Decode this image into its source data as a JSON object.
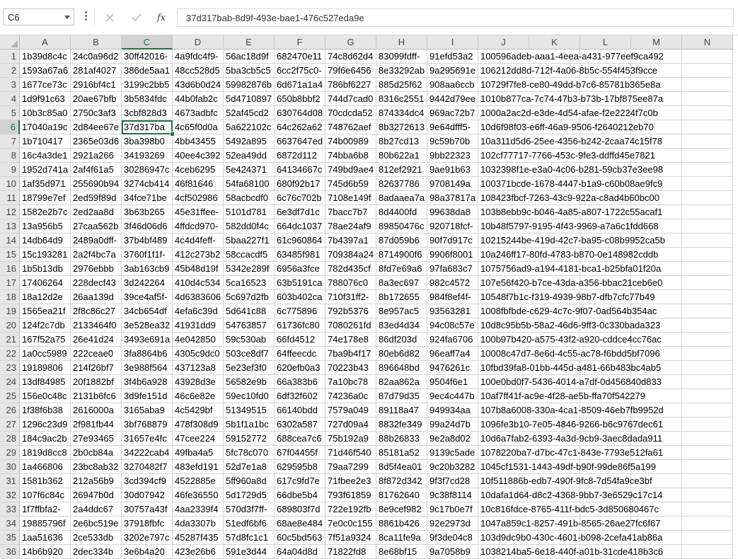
{
  "name_box": {
    "value": "C6"
  },
  "formula_bar": {
    "cancel_icon": "close-icon",
    "enter_icon": "check-icon",
    "fx_label": "fx",
    "value": "37d317bab-8d9f-493e-bae1-476c527eda9e"
  },
  "active_cell": {
    "col": "C",
    "row": 6
  },
  "columns": [
    "A",
    "B",
    "C",
    "D",
    "E",
    "F",
    "G",
    "H",
    "I",
    "J",
    "K",
    "L",
    "M",
    "N"
  ],
  "selected_column": "C",
  "rows": [
    {
      "n": "1",
      "a": "1b39d8c4c",
      "b": "24c0a96d2",
      "c": "30ff42016-",
      "d": "4a9fdc4f9-",
      "e": "56ac18d9f",
      "f": "682470e11",
      "g": "74c8d62d4",
      "h": "83099fdff-",
      "i": "91efd53a2",
      "j": "100596adeb-aaa1-4eea-a431-977eef9ca492"
    },
    {
      "n": "2",
      "a": "1593a67a6",
      "b": "281af4027",
      "c": "386de5aa1",
      "d": "48cc528d5",
      "e": "5ba3cb5c5",
      "f": "6cc2f75c0-",
      "g": "79f6e6456",
      "h": "8e33292ab",
      "i": "9a295691e",
      "j": "106212dd8d-712f-4a06-8b5c-554f453f9cce"
    },
    {
      "n": "3",
      "a": "1677ce73c",
      "b": "2916bf4c1",
      "c": "3199c2bb5",
      "d": "43d6b0d24",
      "e": "59982876b",
      "f": "6d671a1a4",
      "g": "786bf6227",
      "h": "885d25f62",
      "i": "908aa6ccb",
      "j": "10729f7fe8-ce80-49dd-b7c6-85781b365e8a"
    },
    {
      "n": "4",
      "a": "1d9f91c63",
      "b": "20ae67bfb",
      "c": "3b5834fdc",
      "d": "44b0fab2c",
      "e": "5d4710897",
      "f": "650b8bbf2",
      "g": "744d7cad0",
      "h": "8316c2551",
      "i": "9442d79ee",
      "j": "1010b877ca-7c74-47b3-b73b-17bf875ee87a"
    },
    {
      "n": "5",
      "a": "10b3c85a0",
      "b": "2750c3af3",
      "c": "3cbf828d3",
      "d": "4673adbfc",
      "e": "52af45cd2",
      "f": "630764d08",
      "g": "70cdcda52",
      "h": "874334dc4",
      "i": "969ac72b7",
      "j": "1000a2ac2d-e3de-4d54-afae-f2e2224f7c0b"
    },
    {
      "n": "6",
      "a": "17040a19c",
      "b": "2d84ee67e",
      "c": "37d317ba",
      "d": "4c65f0d0a",
      "e": "5a622102c",
      "f": "64c262a62",
      "g": "748762aef",
      "h": "8b3272613",
      "i": "9e64dfff5-",
      "j": "10d6f98f03-e6ff-46a9-9506-f2640212eb70"
    },
    {
      "n": "7",
      "a": "1b710417",
      "b": "2365e03d6",
      "c": "3ba398b0",
      "d": "4bb43455",
      "e": "5492a895",
      "f": "6637647ed",
      "g": "74b00989",
      "h": "8b27cd13",
      "i": "9c59b70b",
      "j": "10a311d5d6-25ee-4356-b242-2caa74c15f78"
    },
    {
      "n": "8",
      "a": "16c4a3de1",
      "b": "2921a266",
      "c": "34193269",
      "d": "40ee4c392",
      "e": "52ea49dd",
      "f": "6872d112",
      "g": "74bba6b8",
      "h": "80b622a1",
      "i": "9bb22323",
      "j": "102cf77717-7766-453c-9fe3-ddffd45e7821"
    },
    {
      "n": "9",
      "a": "1952d741a",
      "b": "2af4f61a5",
      "c": "30286947c",
      "d": "4ceb6295",
      "e": "5e424371",
      "f": "64134667c",
      "g": "749bd9ae4",
      "h": "812ef2921",
      "i": "9ae91b63",
      "j": "1032398f1e-e3a0-4c06-b281-59cb37e3ee98"
    },
    {
      "n": "10",
      "a": "1af35d971",
      "b": "255690b94",
      "c": "3274cb414",
      "d": "46f81646",
      "e": "54fa68100",
      "f": "680f92b17",
      "g": "745d6b59",
      "h": "82637786",
      "i": "9708149a",
      "j": "100371bcde-1678-4447-b1a9-c60b08ae9fc9"
    },
    {
      "n": "11",
      "a": "18799e7ef",
      "b": "2ed59f89d",
      "c": "34fce71be",
      "d": "4cf502986",
      "e": "58acbcdf0",
      "f": "6c76c702b",
      "g": "7108e149f",
      "h": "8adaaea7a",
      "i": "98a37817a",
      "j": "108423fbcf-7263-43c9-922a-c8ad4b60bc00"
    },
    {
      "n": "12",
      "a": "1582e2b7c",
      "b": "2ed2aa8d",
      "c": "3b63b265",
      "d": "45e31ffee-",
      "e": "5101d781",
      "f": "6e3df7d1c",
      "g": "7bacc7b7",
      "h": "8d4400fd",
      "i": "99638da8",
      "j": "103b8ebb9c-b046-4a85-a807-1722c55acaf1"
    },
    {
      "n": "13",
      "a": "13a956b5",
      "b": "27caa562b",
      "c": "3f46d06d6",
      "d": "4ffdcd970-",
      "e": "582dd0f4c",
      "f": "664dc1037",
      "g": "78ae24af9",
      "h": "89850476c",
      "i": "920718fcf-",
      "j": "10b48f5797-9195-4f43-9969-a7a6c1fdd668"
    },
    {
      "n": "14",
      "a": "14db64d9",
      "b": "2489a0dff-",
      "c": "37b4bf489",
      "d": "4c4d4feff-",
      "e": "5baa227f1",
      "f": "61c960864",
      "g": "7b4397a1",
      "h": "87d059b6",
      "i": "90f7d917c",
      "j": "10215244be-419d-42c7-ba95-c08b9952ca5b"
    },
    {
      "n": "15",
      "a": "15c193281",
      "b": "2a2f4bc7a",
      "c": "3760f1f1f-",
      "d": "412c273b2",
      "e": "58ccacdf5",
      "f": "63485f981",
      "g": "709384a24",
      "h": "8714900f6",
      "i": "9906f8001",
      "j": "10a246ff17-80fd-4783-b870-0e148982cddb"
    },
    {
      "n": "16",
      "a": "1b5b13db",
      "b": "2976ebbb",
      "c": "3ab163cb9",
      "d": "45b48d19f",
      "e": "5342e289f",
      "f": "6956a3fce",
      "g": "782d435cf",
      "h": "8fd7e69a6",
      "i": "97fa683c7",
      "j": "1075756ad9-a194-4181-bca1-b25bfa01f20a"
    },
    {
      "n": "17",
      "a": "17406264",
      "b": "228decf43",
      "c": "3d242264",
      "d": "410d4c534",
      "e": "5ca16523",
      "f": "63b5191ca",
      "g": "788076c0",
      "h": "8a3ec697",
      "i": "982c4572",
      "j": "107e56f420-b7ce-43da-a356-bbac21ceb6e0"
    },
    {
      "n": "18",
      "a": "18a12d2e",
      "b": "26aa139d",
      "c": "39ce4af5f-",
      "d": "4d6383606",
      "e": "5c697d2fb",
      "f": "603b402ca",
      "g": "710f31ff2-",
      "h": "8b172655",
      "i": "984f8ef4f-",
      "j": "10548f7b1c-f319-4939-98b7-dfb7cfc77b49"
    },
    {
      "n": "19",
      "a": "1565ea21f",
      "b": "2f8c86c27",
      "c": "34cb654df",
      "d": "4efa6c39d",
      "e": "5d641c88",
      "f": "6c775896",
      "g": "792b5376",
      "h": "8e957ac5",
      "i": "93563281",
      "j": "1008fbfbde-c629-4c7c-9f07-0ad564b354ac"
    },
    {
      "n": "20",
      "a": "124f2c7db",
      "b": "2133464f0",
      "c": "3e528ea32",
      "d": "41931dd9",
      "e": "54763857",
      "f": "61736fc80",
      "g": "7080261fd",
      "h": "83ed4d34",
      "i": "94c08c57e",
      "j": "10d8c95b5b-58a2-46d6-9ff3-0c330bada323"
    },
    {
      "n": "21",
      "a": "167f52a75",
      "b": "26e41d24",
      "c": "3493e691a",
      "d": "4e042850",
      "e": "59c530ab",
      "f": "66fd4512",
      "g": "74e178e8",
      "h": "86df203d",
      "i": "924fa6706",
      "j": "100b97b420-a575-43f2-a920-cddce4cc76ac"
    },
    {
      "n": "22",
      "a": "1a0cc5989",
      "b": "222ceae0",
      "c": "3fa8864b6",
      "d": "4305c9dc0",
      "e": "503ce8df7",
      "f": "64ffeecdc",
      "g": "7ba9b4f17",
      "h": "80eb6d82",
      "i": "96eaff7a4",
      "j": "10008c47d7-8e6d-4c55-ac78-f6bdd5bf7096"
    },
    {
      "n": "23",
      "a": "19189806",
      "b": "214f26bf7",
      "c": "3e988f564",
      "d": "437123a8",
      "e": "5e23ef3f0",
      "f": "620efb0a3",
      "g": "70223b43",
      "h": "896648bd",
      "i": "9476261c",
      "j": "10fbd39fa8-01bb-445d-a481-66b483bc4ab5"
    },
    {
      "n": "24",
      "a": "13df84985",
      "b": "20f1882bf",
      "c": "3f4b6a928",
      "d": "43928d3e",
      "e": "56582e9b",
      "f": "66a383b6",
      "g": "7a10bc78",
      "h": "82aa862a",
      "i": "9504f6e1",
      "j": "100e0bd0f7-5436-4014-a7df-0d456840d833"
    },
    {
      "n": "25",
      "a": "156e0c48c",
      "b": "2131b6fc6",
      "c": "3d9fe151d",
      "d": "46c6e82e",
      "e": "59ec10fd0",
      "f": "6df32f602",
      "g": "74236a0c",
      "h": "87d79d35",
      "i": "9ec4c447b",
      "j": "10af7ff41f-ac9e-4f28-ae5b-ffa70f542279"
    },
    {
      "n": "26",
      "a": "1f38f6b38",
      "b": "2616000a",
      "c": "3165aba9",
      "d": "4c5429bf",
      "e": "51349515",
      "f": "66140bdd",
      "g": "7579a049",
      "h": "89118a47",
      "i": "949934aa",
      "j": "107b8a6008-330a-4ca1-8509-46eb7fb9952d"
    },
    {
      "n": "27",
      "a": "1296c23d9",
      "b": "2f981fb44",
      "c": "3bf768879",
      "d": "478f308d9",
      "e": "5b1f1a1bc",
      "f": "6302a587",
      "g": "727d09a4",
      "h": "8832fe349",
      "i": "99a24d7b",
      "j": "1096fe3b10-7e05-4846-9266-b6c9767dec61"
    },
    {
      "n": "28",
      "a": "184c9ac2b",
      "b": "27e93465",
      "c": "31657e4fc",
      "d": "47cee224",
      "e": "59152772",
      "f": "688cea7c6",
      "g": "75b192a9",
      "h": "88b26833",
      "i": "9e2a8d02",
      "j": "10d6a7fab2-6393-4a3d-9cb9-3aec8dada911"
    },
    {
      "n": "29",
      "a": "1819d8cc8",
      "b": "2b0cb84a",
      "c": "34222cab4",
      "d": "49fba4a5",
      "e": "5fc78c070",
      "f": "67f04455f",
      "g": "71d46f540",
      "h": "85181a52",
      "i": "9139c5ade",
      "j": "1078220ba7-d7bc-47c1-843e-7793e512fa61"
    },
    {
      "n": "30",
      "a": "1a466806",
      "b": "23bc8ab32",
      "c": "3270482f7",
      "d": "483efd191",
      "e": "52d7e1a8",
      "f": "629595b8",
      "g": "79aa7299",
      "h": "8d5f4ea01",
      "i": "9c20b3282",
      "j": "1045cf1531-1443-49df-b90f-99de86f5a199"
    },
    {
      "n": "31",
      "a": "1581b362",
      "b": "212a56b9",
      "c": "3cd394cf9",
      "d": "4522885e",
      "e": "5ff960a8d",
      "f": "617c9fd7e",
      "g": "71fbee2e3",
      "h": "8f872d342",
      "i": "9f3f7cd28",
      "j": "10f511886b-edb7-490f-9fc8-7d54fa9ce3bf"
    },
    {
      "n": "32",
      "a": "107f6c84c",
      "b": "26947b0d",
      "c": "30d07942",
      "d": "46fe36550",
      "e": "5d1729d5",
      "f": "66dbe5b4",
      "g": "793f61859",
      "h": "81762640",
      "i": "9c38f8114",
      "j": "10dafa1d64-d8c2-4368-9bb7-3e6529c17c14"
    },
    {
      "n": "33",
      "a": "1f7ffbfa2-",
      "b": "2a4ddc67",
      "c": "30757a43f",
      "d": "4aa2339f4",
      "e": "570d3f7ff-",
      "f": "689803f7d",
      "g": "722e192fb",
      "h": "8e9cef982",
      "i": "9c17b0e7f",
      "j": "10c816fdce-8765-411f-bdc5-3d850680467c"
    },
    {
      "n": "34",
      "a": "19885796f",
      "b": "2e6bc519e",
      "c": "37918fbfc",
      "d": "4da3307b",
      "e": "51edf6bf6",
      "f": "68ae8e484",
      "g": "7e0c0c155",
      "h": "8861b426",
      "i": "92e2973d",
      "j": "1047a859c1-8257-491b-8565-26ae27fc6f67"
    },
    {
      "n": "35",
      "a": "1aa51636",
      "b": "2ce533db",
      "c": "3202e797c",
      "d": "45287f435",
      "e": "57d8fc1c1",
      "f": "60c5bd563",
      "g": "7f51a9324",
      "h": "8ca11fe9a",
      "i": "9f3de04c8",
      "j": "103d9dc9b0-430c-4601-b098-2cefa41ab86a"
    },
    {
      "n": "36",
      "a": "14b6b920",
      "b": "2dec334b",
      "c": "3e6b4a20",
      "d": "423e26b6",
      "e": "591e3d44",
      "f": "64a04d8d",
      "g": "71822fd8",
      "h": "8e68bf15",
      "i": "9a7058b9",
      "j": "1038214ba5-6e18-440f-a01b-31cde418b3c6"
    }
  ]
}
